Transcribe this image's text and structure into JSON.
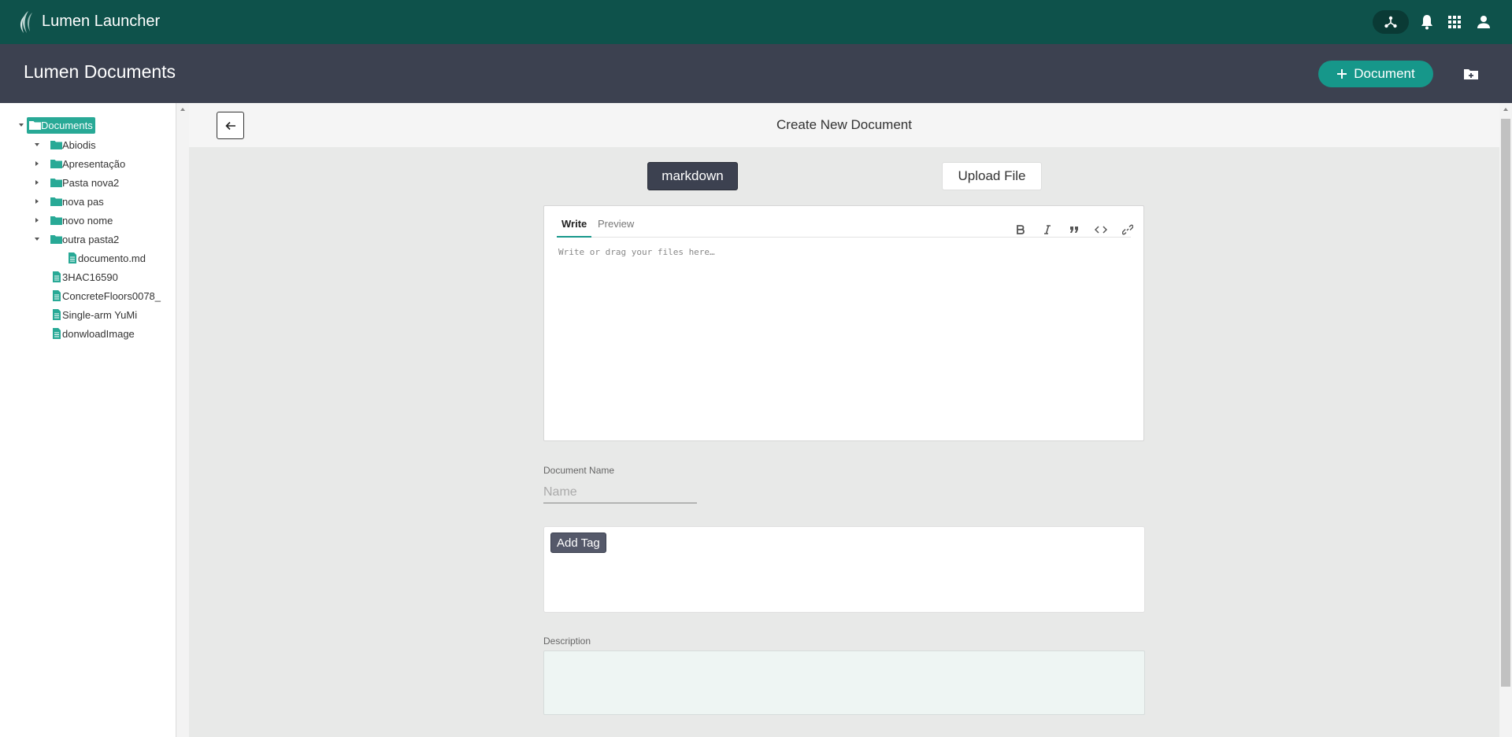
{
  "topbar": {
    "app_title": "Lumen Launcher",
    "icons": [
      "network-icon",
      "bell-icon",
      "apps-grid-icon",
      "user-icon"
    ]
  },
  "subheader": {
    "title": "Lumen Documents",
    "new_document_label": "Document",
    "new_folder_icon": "new-folder-icon"
  },
  "sidebar": {
    "root": "Documents",
    "items": [
      {
        "label": "Abiodis",
        "type": "folder",
        "expanded": true
      },
      {
        "label": "Apresentação",
        "type": "folder",
        "expanded": false
      },
      {
        "label": "Pasta nova2",
        "type": "folder",
        "expanded": false
      },
      {
        "label": "nova pas",
        "type": "folder",
        "expanded": false
      },
      {
        "label": "novo nome",
        "type": "folder",
        "expanded": false
      },
      {
        "label": "outra pasta2",
        "type": "folder",
        "expanded": true
      },
      {
        "label": "documento.md",
        "type": "file",
        "depth": 2
      },
      {
        "label": "3HAC16590",
        "type": "file"
      },
      {
        "label": "ConcreteFloors0078_",
        "type": "file"
      },
      {
        "label": "Single-arm YuMi",
        "type": "file"
      },
      {
        "label": "donwloadImage",
        "type": "file"
      }
    ]
  },
  "main": {
    "title": "Create New Document",
    "markdown_label": "markdown",
    "upload_label": "Upload File",
    "editor": {
      "tab_write": "Write",
      "tab_preview": "Preview",
      "placeholder": "Write or drag your files here…",
      "tools": [
        "bold-icon",
        "italic-icon",
        "quote-icon",
        "code-icon",
        "link-icon"
      ]
    },
    "document_name_label": "Document Name",
    "document_name_placeholder": "Name",
    "add_tag_label": "Add Tag",
    "description_label": "Description"
  },
  "colors": {
    "topbar": "#0e524b",
    "subheader": "#3c4150",
    "accent": "#16978a",
    "tree_selected": "#28a996"
  }
}
